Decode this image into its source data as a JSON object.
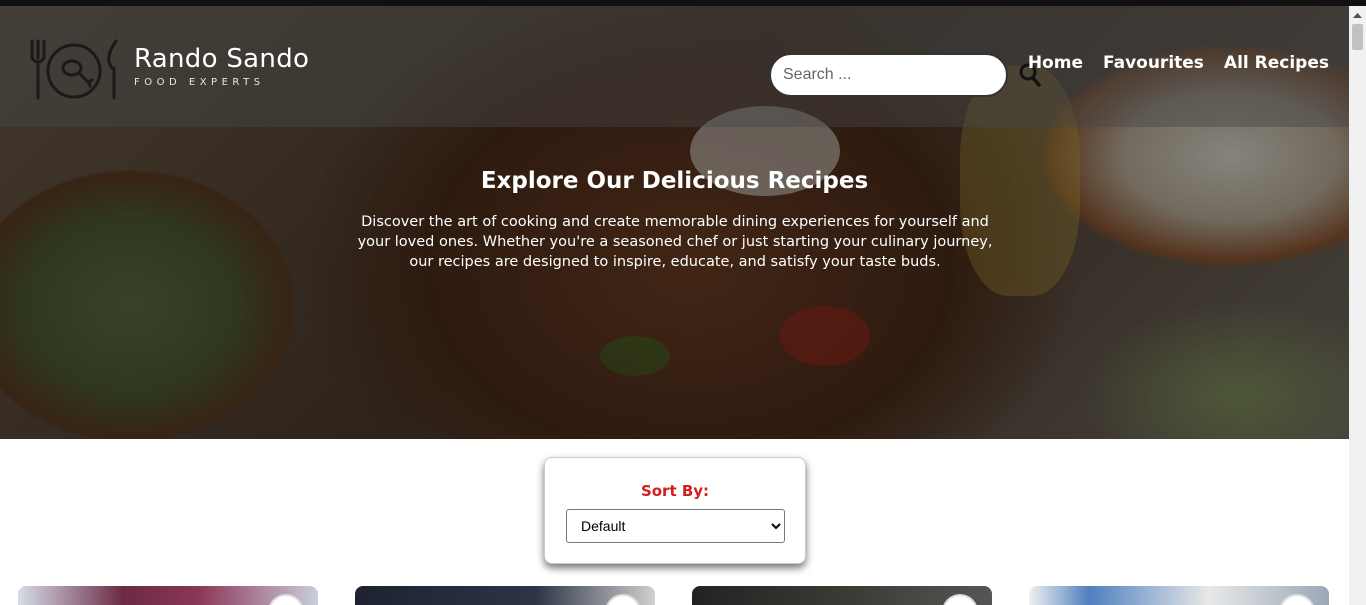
{
  "brand": {
    "name": "Rando Sando",
    "tagline": "FOOD EXPERTS"
  },
  "search": {
    "placeholder": "Search ..."
  },
  "nav": {
    "links": [
      {
        "label": "Home"
      },
      {
        "label": "Favourites"
      },
      {
        "label": "All Recipes"
      }
    ]
  },
  "hero": {
    "title": "Explore Our Delicious Recipes",
    "description": "Discover the art of cooking and create memorable dining experiences for yourself and your loved ones. Whether you're a seasoned chef or just starting your culinary journey, our recipes are designed to inspire, educate, and satisfy your taste buds."
  },
  "sort": {
    "label": "Sort By:",
    "selected": "Default"
  },
  "colors": {
    "accent": "#d61c1c",
    "nav_text": "#ffffff"
  }
}
